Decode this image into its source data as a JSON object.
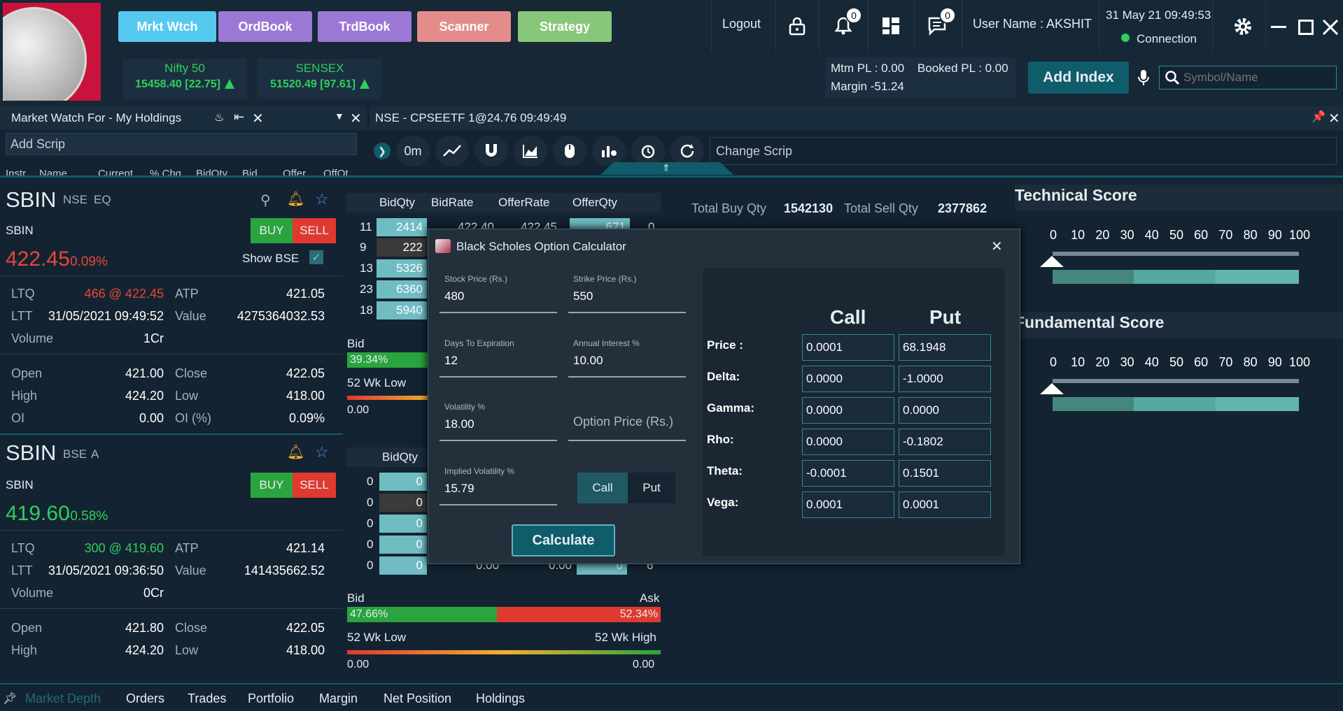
{
  "nav": {
    "market_watch": "Mrkt Wtch",
    "order_book": "OrdBook",
    "trade_book": "TrdBook",
    "scanner": "Scanner",
    "strategy": "Strategy",
    "logout": "Logout",
    "notif_count": "0",
    "msg_count": "0",
    "user": "User Name : AKSHIT",
    "datetime": "31 May 21 09:49:53",
    "connection": "Connection"
  },
  "indices": [
    {
      "name": "Nifty 50",
      "value": "15458.40 [22.75]"
    },
    {
      "name": "SENSEX",
      "value": "51520.49 [97.61]"
    }
  ],
  "pl": {
    "mtm": "Mtm PL : 0.00",
    "booked": "Booked PL : 0.00",
    "margin": "Margin  -51.24"
  },
  "add_index": "Add Index",
  "search_placeholder": "Symbol/Name",
  "watch": {
    "title": "Market Watch For - My Holdings",
    "add_scrip": "Add Scrip",
    "columns": [
      "Instr",
      "Name",
      "Current",
      "% Chg",
      "BidQty",
      "Bid",
      "Offer",
      "OffQt"
    ]
  },
  "chart_header": {
    "title": "NSE - CPSEETF  1@24.76 09:49:49",
    "interval": "0m",
    "change_scrip": "Change Scrip"
  },
  "scrip1": {
    "symbol": "SBIN",
    "exch": "NSE",
    "series": "EQ",
    "name": "SBIN",
    "buy": "BUY",
    "sell": "SELL",
    "ltp": "422.45",
    "chg": "0.09%",
    "show_bse": "Show BSE",
    "rows": [
      {
        "l1": "LTQ",
        "v1": "466 @ 422.45",
        "l2": "ATP",
        "v2": "421.05"
      },
      {
        "l1": "LTT",
        "v1": "31/05/2021 09:49:52",
        "l2": "Value",
        "v2": "4275364032.53"
      },
      {
        "l1": "Volume",
        "v1": "1Cr",
        "l2": "",
        "v2": ""
      },
      {
        "l1": "Open",
        "v1": "421.00",
        "l2": "Close",
        "v2": "422.05"
      },
      {
        "l1": "High",
        "v1": "424.20",
        "l2": "Low",
        "v2": "418.00"
      },
      {
        "l1": "OI",
        "v1": "0.00",
        "l2": "OI (%)",
        "v2": "0.09%"
      }
    ]
  },
  "scrip2": {
    "symbol": "SBIN",
    "exch": "BSE",
    "series": "A",
    "name": "SBIN",
    "buy": "BUY",
    "sell": "SELL",
    "ltp": "419.60",
    "chg": "-0.58%",
    "rows": [
      {
        "l1": "LTQ",
        "v1": "300 @ 419.60",
        "l2": "ATP",
        "v2": "421.14"
      },
      {
        "l1": "LTT",
        "v1": "31/05/2021 09:36:50",
        "l2": "Value",
        "v2": "141435662.52"
      },
      {
        "l1": "Volume",
        "v1": "0Cr",
        "l2": "",
        "v2": ""
      },
      {
        "l1": "Open",
        "v1": "421.80",
        "l2": "Close",
        "v2": "422.05"
      },
      {
        "l1": "High",
        "v1": "424.20",
        "l2": "Low",
        "v2": "418.00"
      }
    ]
  },
  "depth1": {
    "headers": [
      "BidQty",
      "BidRate",
      "OfferRate",
      "OfferQty"
    ],
    "orders": [
      "11",
      "9",
      "13",
      "23",
      "18"
    ],
    "qty": [
      "2414",
      "222",
      "5326",
      "6360",
      "5940"
    ],
    "top_rate": "422.40",
    "top_offer": "422.45",
    "top_offer_qty": "671",
    "top_orders_r": "0",
    "bid_label": "Bid",
    "bid_pct": "39.34%",
    "wk_low": "52 Wk Low",
    "wk_low_val": "0.00",
    "total_buy_label": "Total Buy Qty",
    "total_buy": "1542130",
    "total_sell_label": "Total Sell Qty",
    "total_sell": "2377862"
  },
  "depth2": {
    "headers": [
      "BidQty"
    ],
    "orders": [
      "0",
      "0",
      "0",
      "0",
      "0"
    ],
    "qty": [
      "0",
      "0",
      "0",
      "0",
      "0"
    ],
    "last_rate": "0.00",
    "last_offer": "0.00",
    "last_offer_qty": "0",
    "last_orders_r": "6",
    "bid_label": "Bid",
    "ask_label": "Ask",
    "bid_pct": "47.66%",
    "ask_pct": "52.34%",
    "bid_fraction": 0.4766,
    "wk_low": "52 Wk Low",
    "wk_high": "52 Wk High",
    "wk_low_val": "0.00",
    "wk_high_val": "0.00"
  },
  "scores": {
    "technical": "Technical Score",
    "fundamental": "Fundamental Score",
    "ticks": [
      "0",
      "10",
      "20",
      "30",
      "40",
      "50",
      "60",
      "70",
      "80",
      "90",
      "100"
    ]
  },
  "calc": {
    "title": "Black Scholes Option Calculator",
    "stock_price_label": "Stock Price (Rs.)",
    "stock_price": "480",
    "strike_label": "Strike Price (Rs.)",
    "strike": "550",
    "days_label": "Days To Expiration",
    "days": "12",
    "interest_label": "Annual Interest %",
    "interest": "10.00",
    "vol_label": "Volatility  %",
    "vol": "18.00",
    "option_price_placeholder": "Option Price (Rs.)",
    "iv_label": "Implied Volatility %",
    "iv": "15.79",
    "call_btn": "Call",
    "put_btn": "Put",
    "calculate": "Calculate",
    "call_head": "Call",
    "put_head": "Put",
    "greeks": [
      {
        "label": "Price :",
        "call": "0.0001",
        "put": "68.1948"
      },
      {
        "label": "Delta:",
        "call": "0.0000",
        "put": "-1.0000"
      },
      {
        "label": "Gamma:",
        "call": "0.0000",
        "put": "0.0000"
      },
      {
        "label": "Rho:",
        "call": "0.0000",
        "put": "-0.1802"
      },
      {
        "label": "Theta:",
        "call": "-0.0001",
        "put": "0.1501"
      },
      {
        "label": "Vega:",
        "call": "0.0001",
        "put": "0.0001"
      }
    ]
  },
  "tabs": [
    "Market Depth",
    "Orders",
    "Trades",
    "Portfolio",
    "Margin",
    "Net Position",
    "Holdings"
  ],
  "colors": {
    "accent": "#0f5c6a",
    "buy": "#2aa43e",
    "sell": "#e0392f"
  }
}
